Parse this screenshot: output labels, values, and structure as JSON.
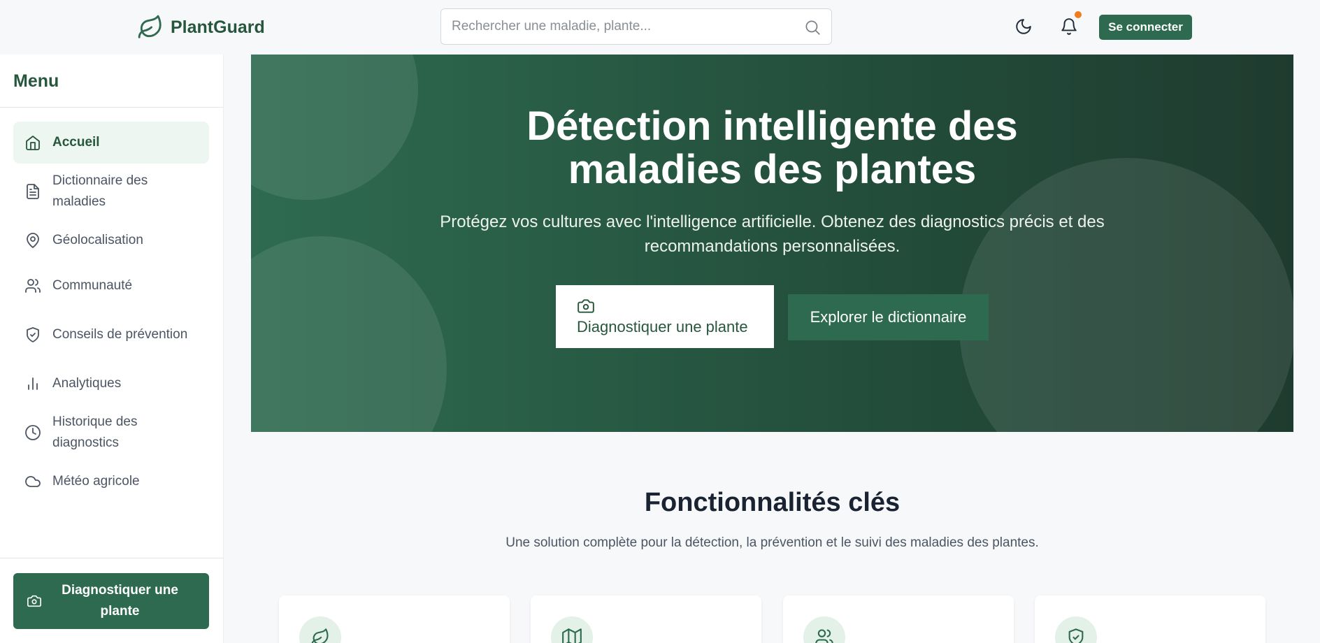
{
  "header": {
    "brand": "PlantGuard",
    "search_placeholder": "Rechercher une maladie, plante...",
    "login_label": "Se connecter"
  },
  "sidebar": {
    "title": "Menu",
    "items": [
      {
        "label": "Accueil",
        "icon": "home-icon",
        "active": true
      },
      {
        "label": "Dictionnaire des maladies",
        "icon": "document-icon"
      },
      {
        "label": "Géolocalisation",
        "icon": "map-pin-icon"
      },
      {
        "label": "Communauté",
        "icon": "users-icon"
      },
      {
        "label": "Conseils de prévention",
        "icon": "shield-check-icon"
      },
      {
        "label": "Analytiques",
        "icon": "bar-chart-icon"
      },
      {
        "label": "Historique des diagnostics",
        "icon": "clock-icon"
      },
      {
        "label": "Météo agricole",
        "icon": "cloud-icon"
      }
    ],
    "cta_label": "Diagnostiquer une plante"
  },
  "hero": {
    "title_line1": "Détection intelligente des",
    "title_line2": "maladies des plantes",
    "subtitle": "Protégez vos cultures avec l'intelligence artificielle. Obtenez des diagnostics précis et des recommandations personnalisées.",
    "diagnose_label": "Diagnostiquer une plante",
    "explore_label": "Explorer le dictionnaire"
  },
  "features": {
    "title": "Fonctionnalités clés",
    "subtitle": "Une solution complète pour la détection, la prévention et le suivi des maladies des plantes.",
    "cards": [
      {
        "icon": "leaf-icon"
      },
      {
        "icon": "map-icon"
      },
      {
        "icon": "users-icon"
      },
      {
        "icon": "shield-check-icon"
      }
    ]
  },
  "colors": {
    "brand": "#2d6a4f",
    "brand_dark": "#26573d",
    "notification_dot": "#f07d1b",
    "active_bg": "#edf6f0"
  }
}
